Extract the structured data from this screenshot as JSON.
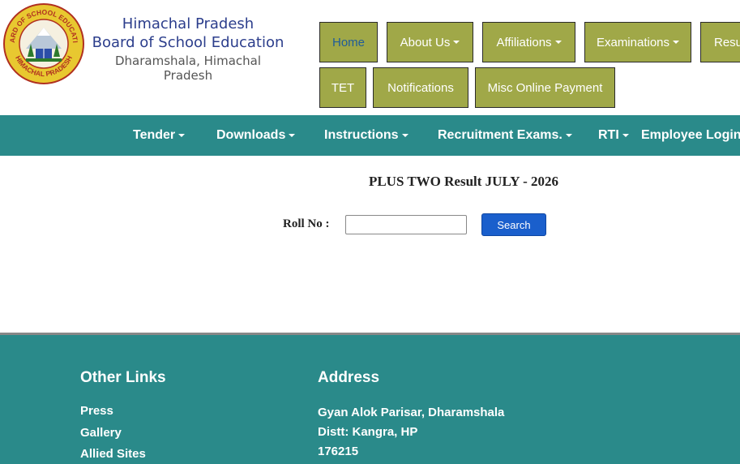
{
  "org": {
    "line1": "Himachal Pradesh",
    "line2": "Board of School Education",
    "line3": "Dharamshala, Himachal Pradesh",
    "logo_ring_top": "BOARD OF SCHOOL EDUCATION",
    "logo_ring_bottom": "HIMACHAL PRADESH"
  },
  "topnav": [
    {
      "label": "Home",
      "active": true
    },
    {
      "label": "About Us",
      "dropdown": true
    },
    {
      "label": "Affiliations",
      "dropdown": true
    },
    {
      "label": "Examinations",
      "dropdown": true
    },
    {
      "label": "Resu"
    },
    {
      "label": "TET"
    },
    {
      "label": "Notifications"
    },
    {
      "label": "Misc Online Payment"
    }
  ],
  "subnav": [
    {
      "label": "Tender",
      "dropdown": true
    },
    {
      "label": "Downloads",
      "dropdown": true
    },
    {
      "label": "Instructions",
      "dropdown": true
    },
    {
      "label": "Recruitment Exams.",
      "dropdown": true
    },
    {
      "label": "RTI",
      "dropdown": true
    },
    {
      "label": "Employee Login"
    }
  ],
  "result": {
    "title": "PLUS TWO Result JULY - 2026",
    "roll_label": "Roll No :",
    "roll_value": "",
    "search_label": "Search"
  },
  "footer": {
    "links_heading": "Other Links",
    "links": [
      "Press",
      "Gallery",
      "Allied Sites"
    ],
    "address_heading": "Address",
    "address_lines": [
      "Gyan Alok Parisar, Dharamshala",
      "Distt: Kangra, HP",
      "176215"
    ]
  },
  "colors": {
    "nav_olive": "#a0a848",
    "teal": "#2a8a8a",
    "brand_blue": "#2c3e8c",
    "search_blue": "#1a5fcc"
  }
}
